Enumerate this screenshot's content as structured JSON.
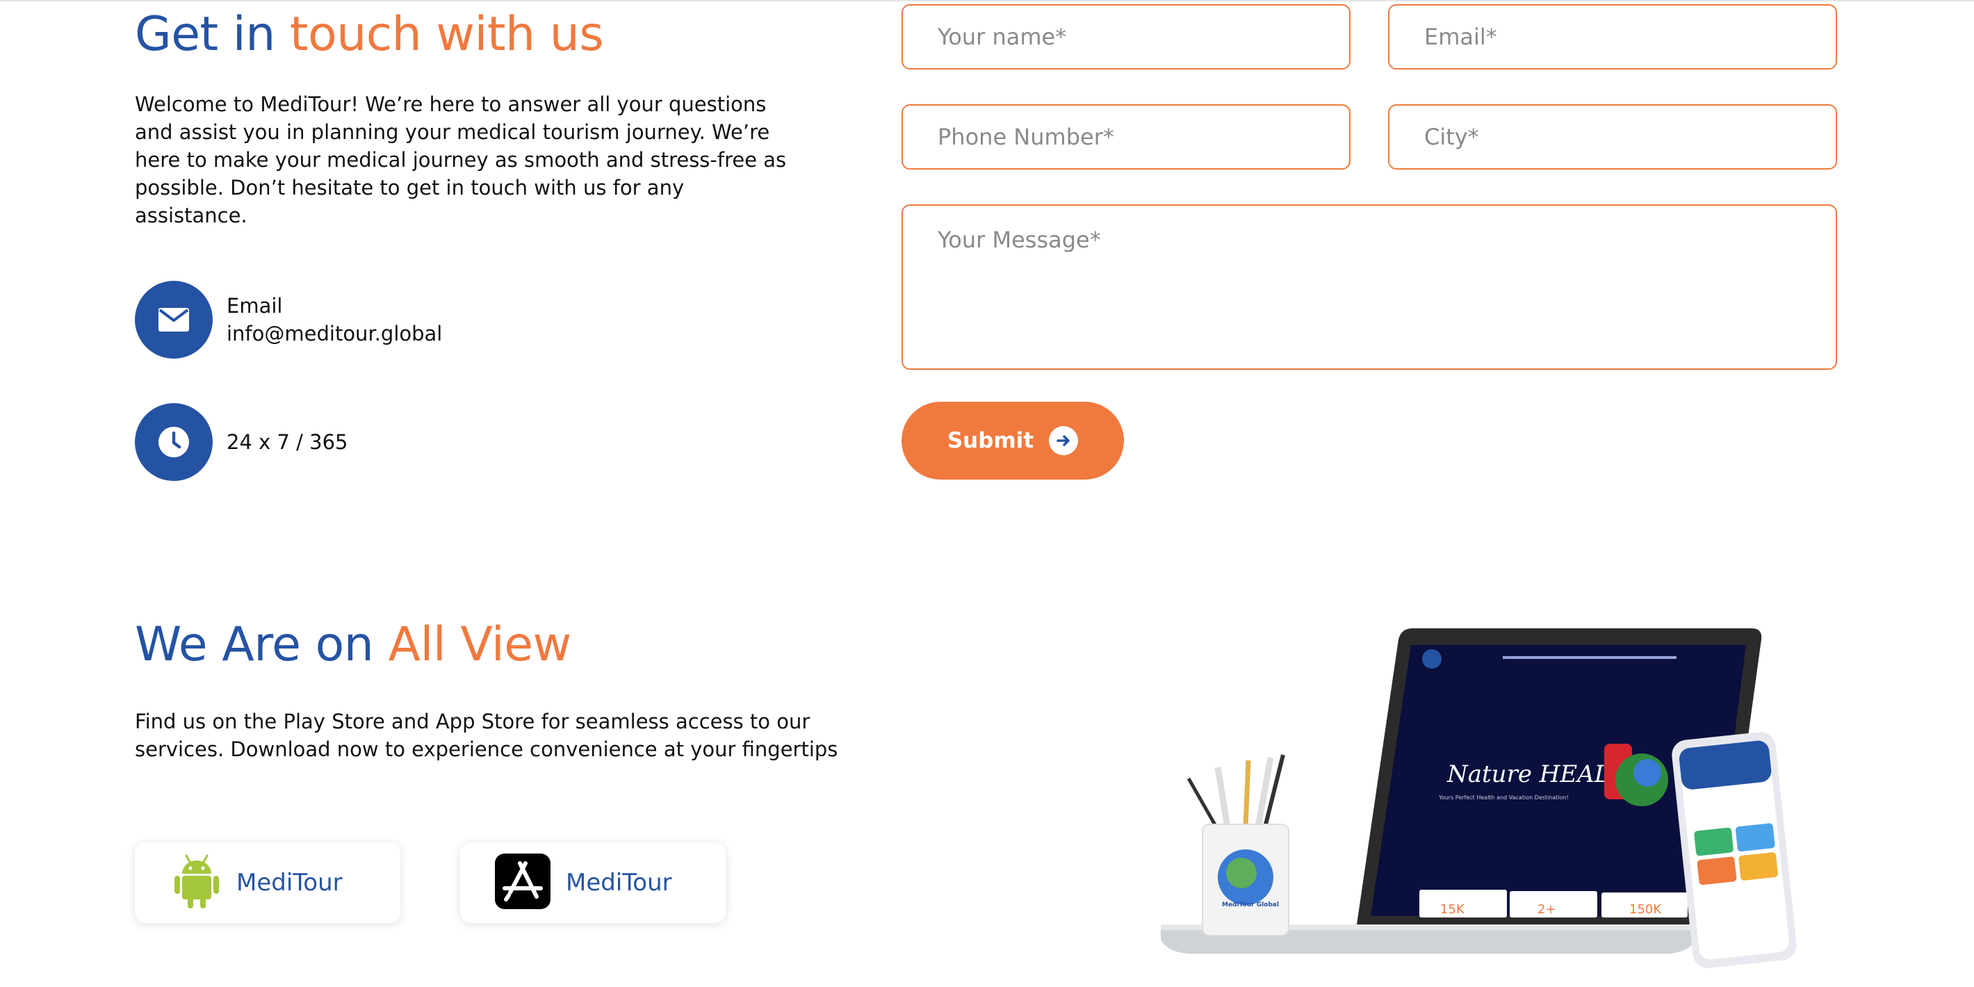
{
  "contact": {
    "heading_part1": "Get in ",
    "heading_part2": "touch with us",
    "intro": "Welcome to MediTour! We’re here to answer all your questions and assist you in planning your medical tourism journey. We’re here to make your medical journey as smooth and stress-free as possible. Don’t hesitate to get in touch with us for any assistance.",
    "email_label": "Email",
    "email_value": "info@meditour.global",
    "hours": "24 x 7 / 365"
  },
  "form": {
    "name_placeholder": "Your name*",
    "email_placeholder": "Email*",
    "phone_placeholder": "Phone Number*",
    "city_placeholder": "City*",
    "message_placeholder": "Your Message*",
    "submit_label": "Submit"
  },
  "apps": {
    "heading_part1": "We Are on ",
    "heading_part2": "All View",
    "description": "Find us on the Play Store and App Store for seamless access to our services. Download now to experience convenience at your fingertips",
    "android_label": "MediTour",
    "ios_label": "MediTour"
  },
  "mockup": {
    "hero_title": "Nature HEALS",
    "hero_subtitle": "Yours Perfect Health and Vacation Destination!",
    "stat1": "15K",
    "stat2": "2+",
    "stat3": "150K",
    "cup_label": "MediTour Global"
  },
  "colors": {
    "blue": "#2553a3",
    "orange": "#f0793e",
    "navy": "#0a0f3d",
    "android_green": "#a4c639"
  }
}
